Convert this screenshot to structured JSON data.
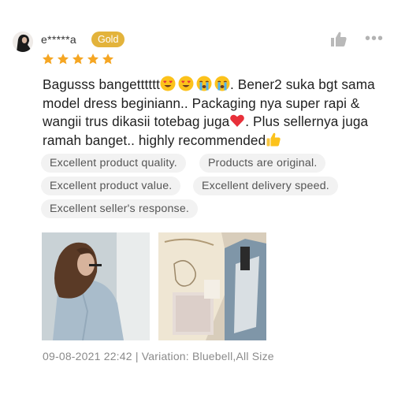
{
  "review": {
    "username": "e*****a",
    "badge": "Gold",
    "rating": 5,
    "text_1": "Bagusss bangetttttt",
    "text_2": ". Bener2 suka bgt sama model dress beginiann.. Packaging nya super rapi & wangii trus dikasii totebag juga",
    "text_3": ". Plus sellernya juga ramah banget.. highly recommended",
    "tags": [
      "Excellent product quality.",
      "Products are original.",
      "Excellent product value.",
      "Excellent delivery speed.",
      "Excellent seller's response."
    ],
    "date": "09-08-2021 22:42",
    "variation": "Variation: Bluebell,All Size"
  },
  "icons": {
    "avatar": "user-avatar",
    "like": "thumbs-up-icon",
    "more": "more-options-icon",
    "star": "star-icon",
    "emojis": [
      "heart-eyes-emoji",
      "heart-eyes-emoji",
      "crying-emoji",
      "crying-emoji",
      "red-heart-emoji",
      "thumbs-up-emoji"
    ]
  },
  "colors": {
    "badge": "#e3b33b",
    "star": "#f5a623",
    "tag_bg": "#f2f2f2",
    "meta_text": "#8a8a8a"
  }
}
